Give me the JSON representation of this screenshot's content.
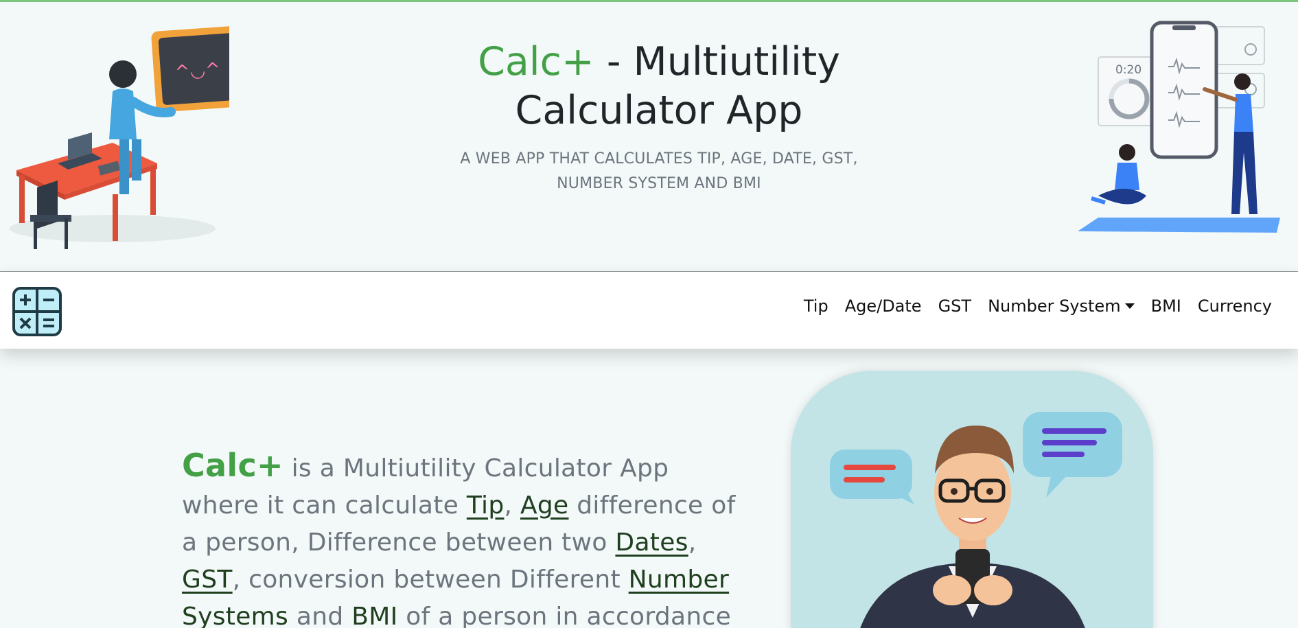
{
  "hero": {
    "brand": "Calc+",
    "title_rest": " - Multiutility Calculator App",
    "subtitle": "A WEB APP THAT CALCULATES TIP, AGE, DATE, GST, NUMBER SYSTEM AND BMI",
    "timer_readout": "0:20"
  },
  "nav": {
    "logo_icon": "calculator-icon",
    "items": [
      {
        "label": "Tip"
      },
      {
        "label": "Age/Date"
      },
      {
        "label": "GST"
      },
      {
        "label": "Number System",
        "dropdown": true
      },
      {
        "label": "BMI"
      },
      {
        "label": "Currency"
      }
    ]
  },
  "intro": {
    "brand": "Calc+",
    "t1": " is a Multiutility Calculator App where it can calculate ",
    "link_tip": "Tip",
    "t2": ", ",
    "link_age": "Age",
    "t3": " difference of a person, Difference between two ",
    "link_dates": "Dates",
    "t4": ", ",
    "link_gst": "GST",
    "t5": ", conversion between Different ",
    "link_number_systems": "Number Systems",
    "t6": " and ",
    "link_bmi": "BMI",
    "t7": " of a person in accordance"
  },
  "colors": {
    "brand_green": "#43a047",
    "page_bg": "#f3f9f8",
    "card_bg": "#c3e4e7"
  }
}
